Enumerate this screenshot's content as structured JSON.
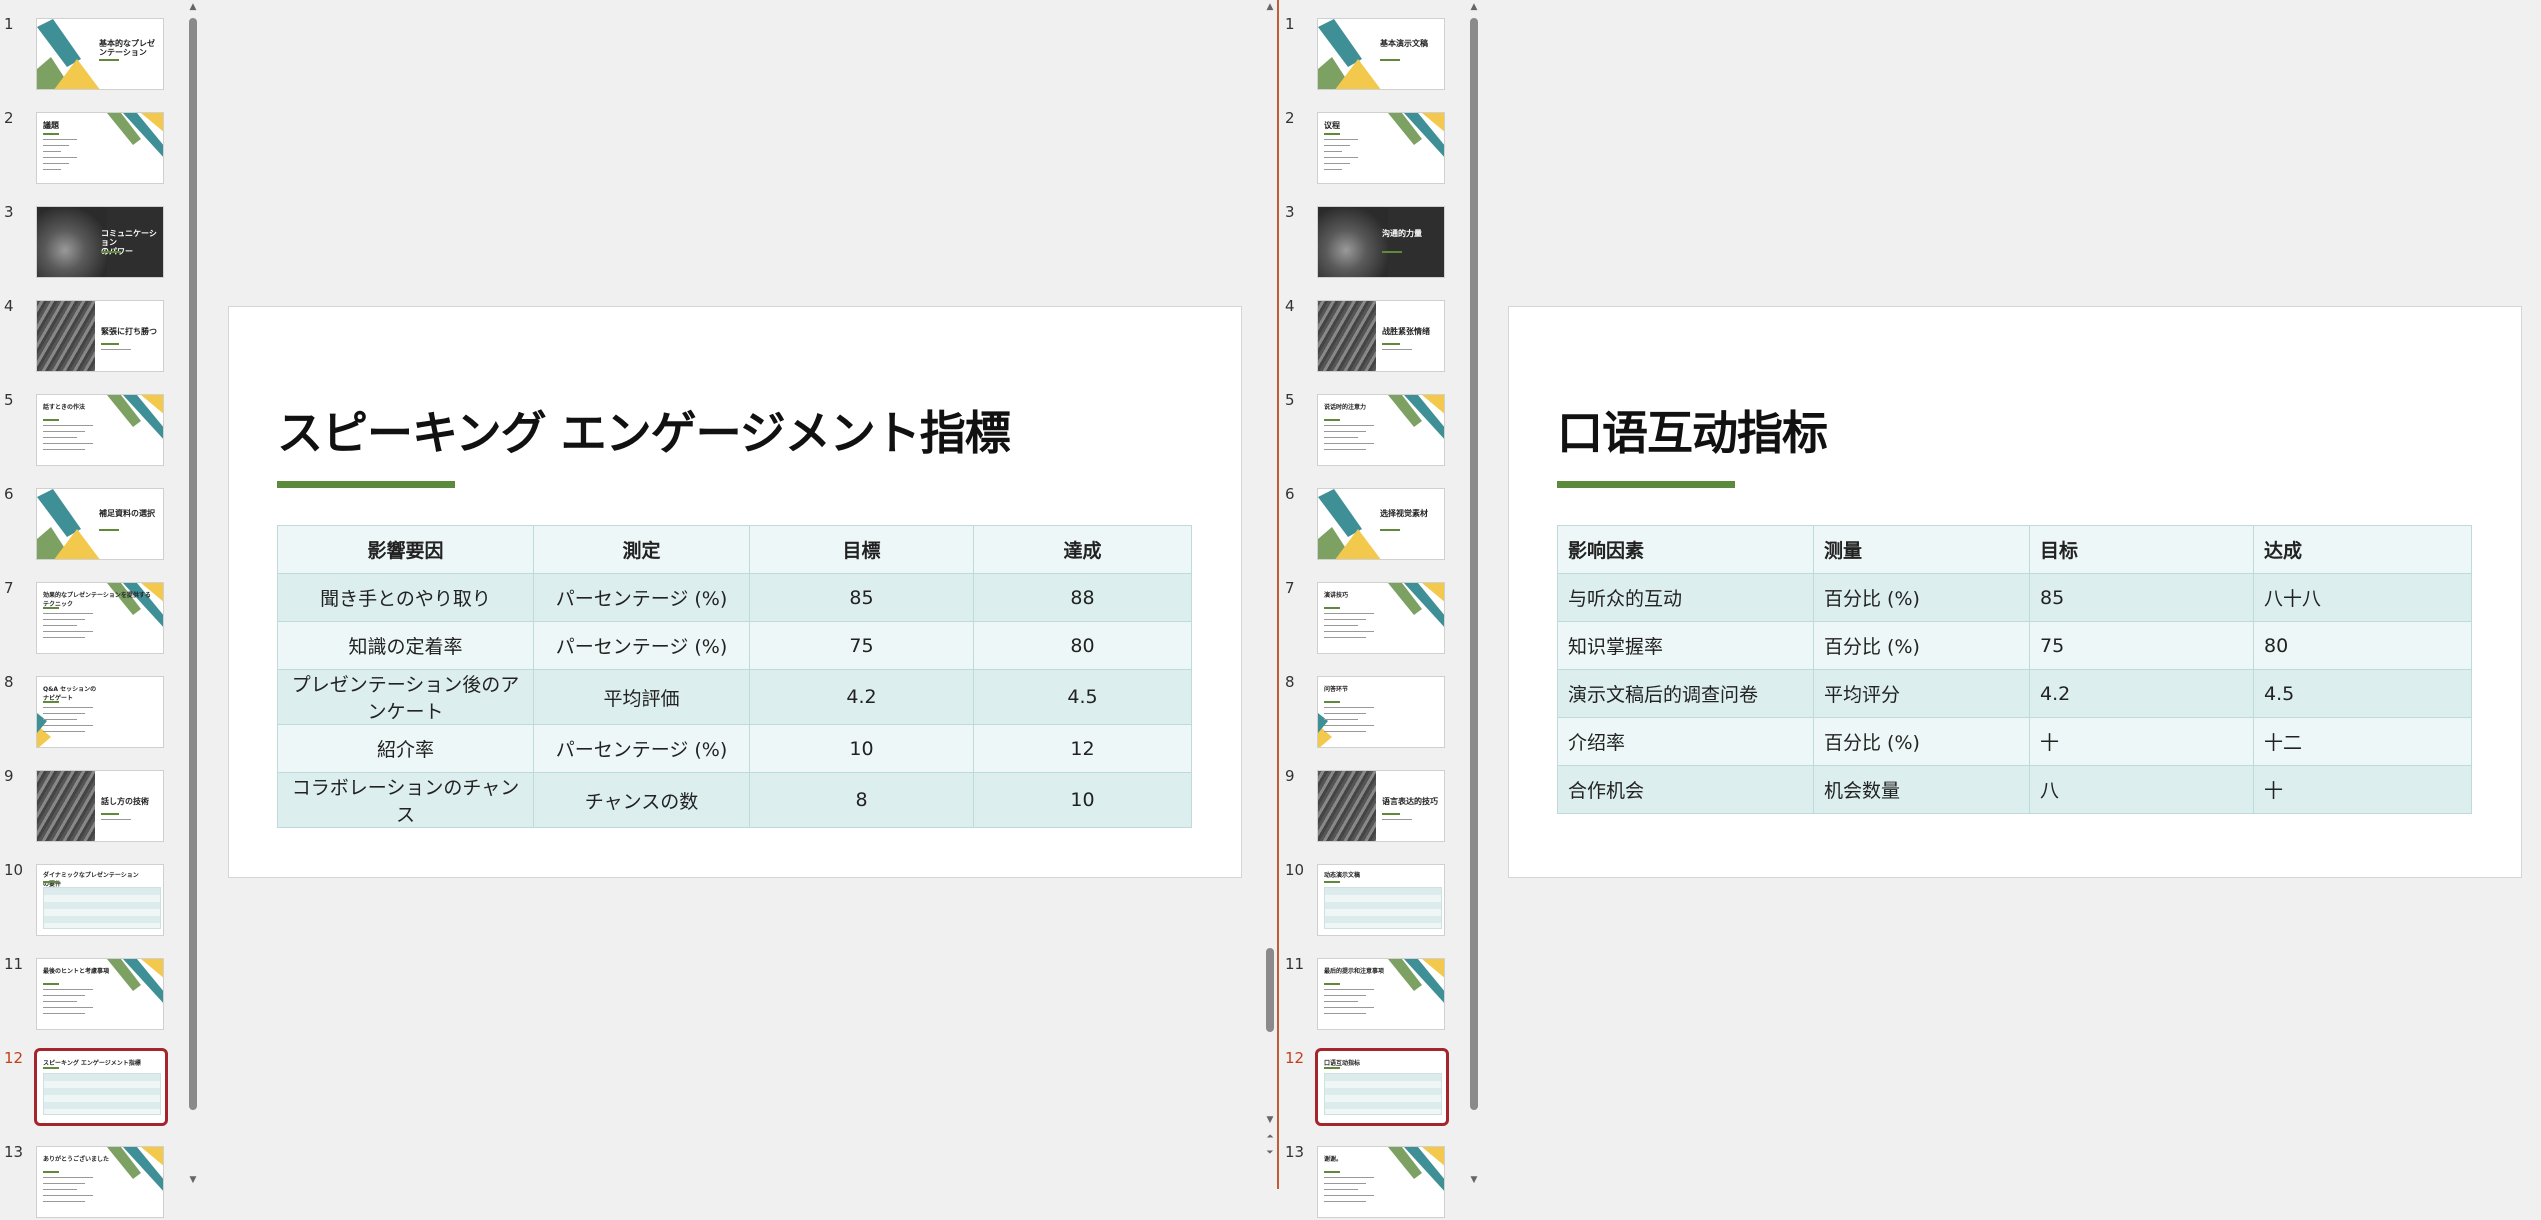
{
  "left": {
    "thumbnails": [
      {
        "num": "1",
        "title": "基本的なプレゼ\nンテーション",
        "style": "geo",
        "dark": false
      },
      {
        "num": "2",
        "title": "議題",
        "style": "list",
        "dark": false
      },
      {
        "num": "3",
        "title": "コミュニケーション\nのパワー",
        "style": "photo",
        "dark": true
      },
      {
        "num": "4",
        "title": "緊張に打ち勝つ",
        "style": "photo-half",
        "dark": false
      },
      {
        "num": "5",
        "title": "話すときの作法",
        "style": "text",
        "dark": false
      },
      {
        "num": "6",
        "title": "補足資料の選択",
        "style": "geo",
        "dark": false
      },
      {
        "num": "7",
        "title": "効果的なプレゼンテーションを提供する\nテクニック",
        "style": "text",
        "dark": false
      },
      {
        "num": "8",
        "title": "Q&A セッションの\nナビゲート",
        "style": "text",
        "dark": false
      },
      {
        "num": "9",
        "title": "話し方の技術",
        "style": "photo-half",
        "dark": false
      },
      {
        "num": "10",
        "title": "ダイナミックなプレゼンテーション\nの要件",
        "style": "table",
        "dark": false
      },
      {
        "num": "11",
        "title": "最後のヒントと考慮事項",
        "style": "text",
        "dark": false
      },
      {
        "num": "12",
        "title": "スピーキング エンゲージメント指標",
        "style": "table",
        "dark": false,
        "selected": true
      },
      {
        "num": "13",
        "title": "ありがとうございました",
        "style": "text",
        "dark": false
      }
    ],
    "slide": {
      "title": "スピーキング エンゲージメント指標",
      "headers": [
        "影響要因",
        "測定",
        "目標",
        "達成"
      ],
      "rows": [
        [
          "聞き手とのやり取り",
          "パーセンテージ (%)",
          "85",
          "88"
        ],
        [
          "知識の定着率",
          "パーセンテージ (%)",
          "75",
          "80"
        ],
        [
          "プレゼンテーション後のアンケート",
          "平均評価",
          "4.2",
          "4.5"
        ],
        [
          "紹介率",
          "パーセンテージ (%)",
          "10",
          "12"
        ],
        [
          "コラボレーションのチャンス",
          "チャンスの数",
          "8",
          "10"
        ]
      ]
    }
  },
  "right": {
    "thumbnails": [
      {
        "num": "1",
        "title": "基本演示文稿",
        "style": "geo",
        "dark": false
      },
      {
        "num": "2",
        "title": "议程",
        "style": "list",
        "dark": false
      },
      {
        "num": "3",
        "title": "沟通的力量",
        "style": "photo",
        "dark": true
      },
      {
        "num": "4",
        "title": "战胜紧张情绪",
        "style": "photo-half",
        "dark": false
      },
      {
        "num": "5",
        "title": "说话时的注意力",
        "style": "text",
        "dark": false
      },
      {
        "num": "6",
        "title": "选择视觉素材",
        "style": "geo",
        "dark": false
      },
      {
        "num": "7",
        "title": "演讲技巧",
        "style": "text",
        "dark": false
      },
      {
        "num": "8",
        "title": "问答环节",
        "style": "text",
        "dark": false
      },
      {
        "num": "9",
        "title": "语言表达的技巧",
        "style": "photo-half",
        "dark": false
      },
      {
        "num": "10",
        "title": "动态演示文稿",
        "style": "table",
        "dark": false
      },
      {
        "num": "11",
        "title": "最后的提示和注意事项",
        "style": "text",
        "dark": false
      },
      {
        "num": "12",
        "title": "口语互动指标",
        "style": "table",
        "dark": false,
        "selected": true
      },
      {
        "num": "13",
        "title": "谢谢。",
        "style": "text",
        "dark": false
      }
    ],
    "slide": {
      "title": "口语互动指标",
      "headers": [
        "影响因素",
        "测量",
        "目标",
        "达成"
      ],
      "rows": [
        [
          "与听众的互动",
          "百分比 (%)",
          "85",
          "八十八"
        ],
        [
          "知识掌握率",
          "百分比 (%)",
          "75",
          "80"
        ],
        [
          "演示文稿后的调查问卷",
          "平均评分",
          "4.2",
          "4.5"
        ],
        [
          "介绍率",
          "百分比 (%)",
          "十",
          "十二"
        ],
        [
          "合作机会",
          "机会数量",
          "八",
          "十"
        ]
      ]
    }
  },
  "colors": {
    "accent_green": "#5b8a3c",
    "teal": "#3f8f97",
    "yellow": "#f2c94c",
    "selected_border": "#a4262c",
    "divider": "#c55a3a"
  }
}
